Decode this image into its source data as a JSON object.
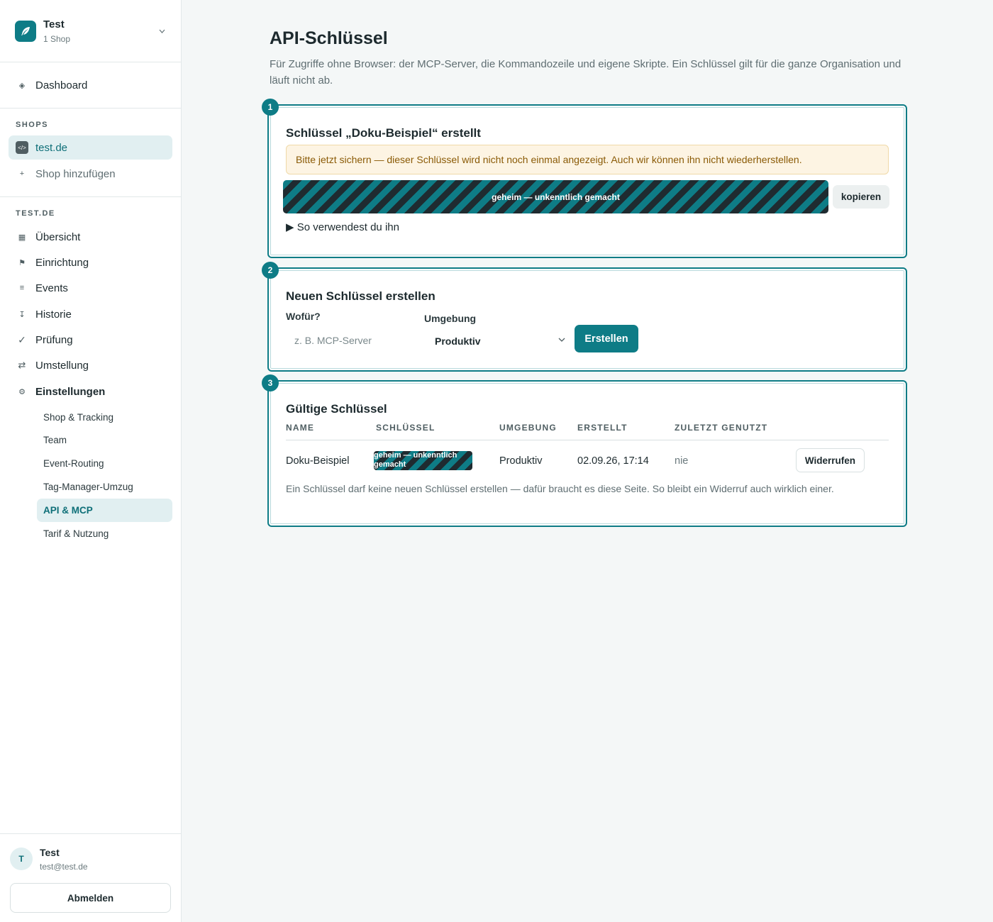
{
  "org": {
    "name": "Test",
    "subtitle": "1 Shop",
    "logo_icon": "feather-icon"
  },
  "nav": {
    "dashboard": "Dashboard"
  },
  "shops": {
    "label": "SHOPS",
    "items": [
      {
        "label": "test.de",
        "icon": "code-icon",
        "icon_glyph": "</>"
      },
      {
        "label": "Shop hinzufügen",
        "icon": "plus-icon"
      }
    ]
  },
  "shop_nav": {
    "label": "TEST.DE",
    "items": [
      {
        "label": "Übersicht",
        "icon": "grid-icon"
      },
      {
        "label": "Einrichtung",
        "icon": "flag-icon"
      },
      {
        "label": "Events",
        "icon": "list-icon"
      },
      {
        "label": "Historie",
        "icon": "history-icon"
      },
      {
        "label": "Prüfung",
        "icon": "check-icon"
      },
      {
        "label": "Umstellung",
        "icon": "swap-icon"
      },
      {
        "label": "Einstellungen",
        "icon": "gear-icon"
      }
    ],
    "settings": [
      {
        "label": "Shop & Tracking"
      },
      {
        "label": "Team"
      },
      {
        "label": "Event-Routing"
      },
      {
        "label": "Tag-Manager-Umzug"
      },
      {
        "label": "API & MCP",
        "active": true
      },
      {
        "label": "Tarif & Nutzung"
      }
    ]
  },
  "user": {
    "initial": "T",
    "name": "Test",
    "email": "test@test.de",
    "logout": "Abmelden"
  },
  "page": {
    "title": "API-Schlüssel",
    "description": "Für Zugriffe ohne Browser: der MCP-Server, die Kommandozeile und eigene Skripte. Ein Schlüssel gilt für die ganze Organisation und läuft nicht ab."
  },
  "created": {
    "step": "1",
    "title": "Schlüssel „Doku-Beispiel“ erstellt",
    "warning": "Bitte jetzt sichern — dieser Schlüssel wird nicht noch einmal angezeigt. Auch wir können ihn nicht wiederherstellen.",
    "secret": "geheim — unkenntlich gemacht",
    "copy": "kopieren",
    "usage": "▶ So verwendest du ihn"
  },
  "new_key": {
    "step": "2",
    "title": "Neuen Schlüssel erstellen",
    "purpose_label": "Wofür?",
    "purpose_placeholder": "z. B. MCP-Server",
    "env_label": "Umgebung",
    "env_value": "Produktiv",
    "create": "Erstellen"
  },
  "keys": {
    "step": "3",
    "title": "Gültige Schlüssel",
    "columns": [
      "NAME",
      "SCHLÜSSEL",
      "UMGEBUNG",
      "ERSTELLT",
      "ZULETZT GENUTZT"
    ],
    "rows": [
      {
        "name": "Doku-Beispiel",
        "key": "geheim — unkenntlich gemacht",
        "env": "Produktiv",
        "created": "02.09.26, 17:14",
        "last_used": "nie",
        "action": "Widerrufen"
      }
    ],
    "note": "Ein Schlüssel darf keine neuen Schlüssel erstellen — dafür braucht es diese Seite. So bleibt ein Widerruf auch wirklich einer."
  },
  "colors": {
    "accent": "#0e7c86",
    "warning_bg": "#fdf4e3",
    "warning_text": "#8a5a06"
  }
}
